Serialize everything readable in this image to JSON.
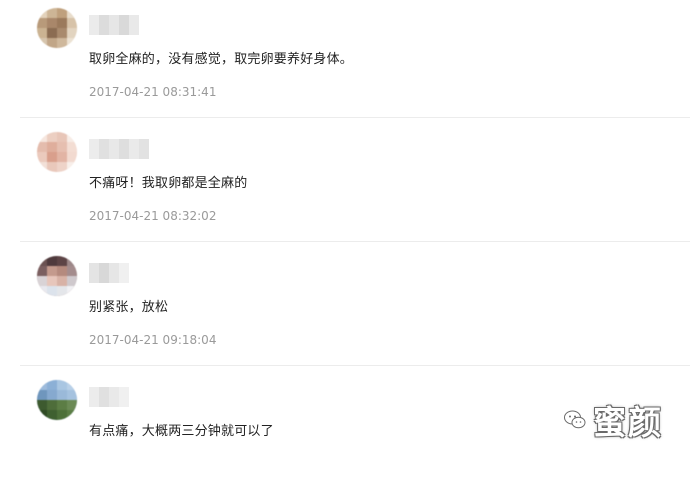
{
  "comments": [
    {
      "text": "取卵全麻的，没有感觉，取完卵要养好身体。",
      "timestamp": "2017-04-21 08:31:41"
    },
    {
      "text": "不痛呀！我取卵都是全麻的",
      "timestamp": "2017-04-21 08:32:02"
    },
    {
      "text": "别紧张，放松",
      "timestamp": "2017-04-21 09:18:04"
    },
    {
      "text": "有点痛，大概两三分钟就可以了",
      "timestamp": ""
    }
  ],
  "watermark": {
    "text": "蜜颜",
    "icon": "wechat-logo-icon"
  },
  "colors": {
    "text": "#222222",
    "timestamp": "#9a9a9a",
    "divider": "#ececec",
    "background": "#ffffff"
  }
}
